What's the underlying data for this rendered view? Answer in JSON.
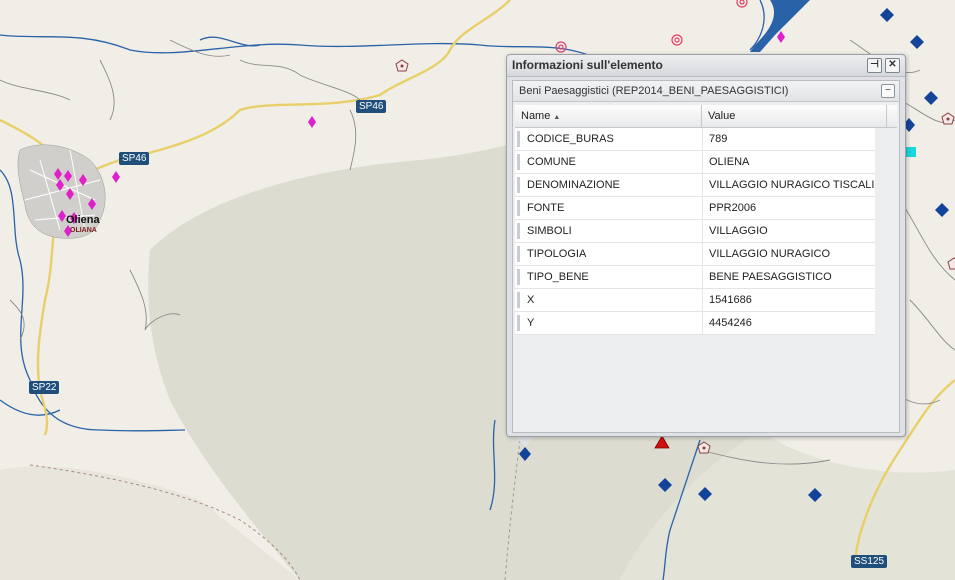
{
  "map": {
    "road_labels": [
      "SP46",
      "SP46",
      "SP22",
      "SS125"
    ],
    "town": {
      "name": "Oliena",
      "sub": "OLIANA"
    },
    "colors": {
      "background": "#f0eee7",
      "relief": "#dcdcd0",
      "river": "#2a62a8",
      "road": "#e9cf6a",
      "poi_magenta": "#e020c8",
      "poi_blue": "#14449a",
      "poi_red": "#d01010",
      "label_bg": "#1f4f7a"
    }
  },
  "popup": {
    "title": "Informazioni sull'elemento",
    "pin_icon": "pin-icon",
    "close_icon": "close-icon",
    "panel_title": "Beni Paesaggistici (REP2014_BENI_PAESAGGISTICI)",
    "collapse_label": "−",
    "columns": {
      "name": "Name",
      "value": "Value"
    },
    "rows": [
      {
        "name": "CODICE_BURAS",
        "value": "789"
      },
      {
        "name": "COMUNE",
        "value": "OLIENA"
      },
      {
        "name": "DENOMINAZIONE",
        "value": "VILLAGGIO NURAGICO TISCALI"
      },
      {
        "name": "FONTE",
        "value": "PPR2006"
      },
      {
        "name": "SIMBOLI",
        "value": "VILLAGGIO"
      },
      {
        "name": "TIPOLOGIA",
        "value": "VILLAGGIO NURAGICO"
      },
      {
        "name": "TIPO_BENE",
        "value": "BENE PAESAGGISTICO"
      },
      {
        "name": "X",
        "value": "1541686"
      },
      {
        "name": "Y",
        "value": "4454246"
      }
    ]
  }
}
